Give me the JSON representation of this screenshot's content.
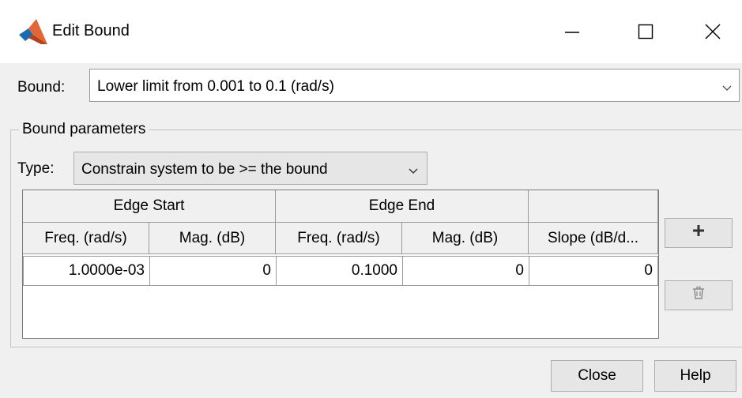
{
  "window": {
    "title": "Edit Bound",
    "icon": "matlab-logo-icon",
    "controls": [
      "minimize-icon",
      "maximize-icon",
      "close-icon"
    ]
  },
  "bound": {
    "label": "Bound:",
    "selected": "Lower limit from 0.001 to 0.1 (rad/s)"
  },
  "parameters": {
    "group_title": "Bound parameters",
    "type_label": "Type:",
    "type_selected": "Constrain system to be >= the bound"
  },
  "table": {
    "group_headers": [
      "Edge Start",
      "Edge End",
      ""
    ],
    "columns": [
      "Freq. (rad/s)",
      "Mag. (dB)",
      "Freq. (rad/s)",
      "Mag. (dB)",
      "Slope (dB/d..."
    ],
    "rows": [
      [
        "1.0000e-03",
        "0",
        "0.1000",
        "0",
        "0"
      ]
    ]
  },
  "side_buttons": {
    "add_icon": "plus-icon",
    "delete_icon": "trash-icon"
  },
  "buttons": {
    "close": "Close",
    "help": "Help"
  }
}
